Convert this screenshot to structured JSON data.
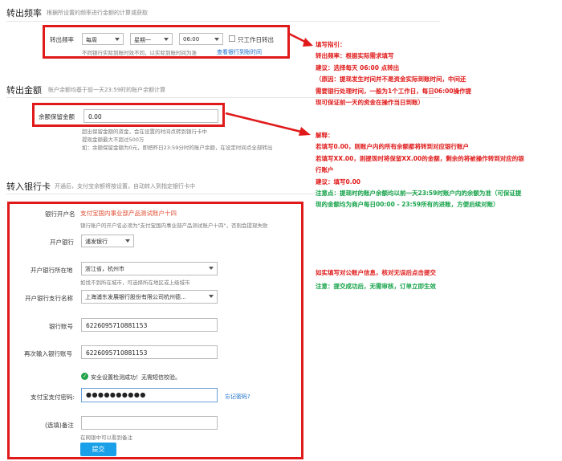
{
  "sections": {
    "freq_title": "转出频率",
    "freq_desc": "根据所设置的频率进行金额的计算或获取",
    "amount_title": "转出金额",
    "amount_desc": "账户余额均基于前一天23:59时的账户余额计算",
    "bank_title": "转入银行卡",
    "bank_desc": "开通后，支付宝余额将按设置，自动转入到指定银行卡中"
  },
  "freq_form": {
    "label": "转出频率",
    "frequency": "每周",
    "weekday": "星期一",
    "time": "06:00",
    "workday_checkbox": "只工作日转出",
    "note": "不同银行实际到账时效不同，以实际到账时间为准",
    "note_link": "查看银行到账时间"
  },
  "amount_form": {
    "label": "余额保留金额",
    "value": "0.00",
    "notes": [
      "超出保留金额的资金，会在设置的时间点转到银行卡中",
      "提现金额最大不超过500万",
      "如：余额保留金额为0元，即把昨日23:59分时的账户余额，在设定时间点全部转出"
    ]
  },
  "bank_form": {
    "account_name_label": "银行开户名",
    "account_name_value": "支付宝国内事业部产品测试账户十四",
    "account_name_note": "银行账户的开户名必须为\"支付宝国内事业部产品测试账户十四\"，否则会提现失败",
    "bank_label": "开户银行",
    "bank_value": "浦发银行",
    "location_label": "开户银行所在地",
    "location_value": "浙江省，杭州市",
    "location_note": "如找不到所在城市，可选择所在地区或上级城市",
    "branch_label": "开户银行支行名称",
    "branch_value": "上海浦东发展银行股份有限公司杭州德...",
    "account_label": "银行账号",
    "account_value": "6226095710881153",
    "account_confirm_label": "再次输入银行账号",
    "account_confirm_value": "6226095710881153",
    "security_msg": "安全设置检测成功！无需短信校验。",
    "password_label": "支付宝支付密码:",
    "password_value": "●●●●●●●●●●",
    "forgot_link": "忘记密码?",
    "remark_label": "(选填)备注",
    "remark_note": "在网银中可以看到备注",
    "submit_label": "提交"
  },
  "annotations": {
    "freq": [
      "填写指引：",
      "转出频率：根据实际需求填写",
      "建议：选择每天 06:00 点转出",
      "（原因：提现发生时间并不是资金实际到账时间，中间还",
      "需要银行处理时间，一般为1个工作日，每日06:00操作提",
      "现可保证前一天的资金在操作当日到账）"
    ],
    "amount": [
      "解释：",
      "若填写0.00，则账户内的所有余额都将转到对应银行账户",
      "若填写XX.00，则提现时将保留XX.00的金额，剩余的将被操作转到对应的银",
      "行账户",
      "建议：填写0.00"
    ],
    "amount_note": [
      "注意点：提现时的账户余额均以前一天23:59时账户内的余额为准（可保证提",
      "现的金额均为商户每日00:00 - 23:59所有的进账，方便后续对账）"
    ],
    "bank_red": "如实填写对公账户信息，核对无误后点击提交",
    "bank_green": "注意：提交成功后，无需审核，订单立即生效"
  },
  "colors": {
    "annotation_red": "#e01a1a",
    "annotation_green": "#16a34a",
    "link": "#1a6fc9",
    "submit": "#1aa0e8"
  }
}
